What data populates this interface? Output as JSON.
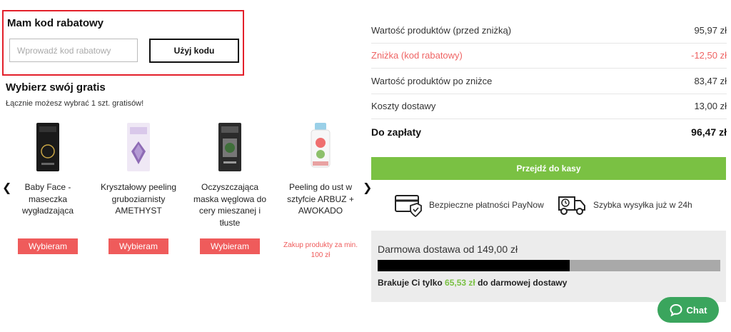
{
  "coupon": {
    "title": "Mam kod rabatowy",
    "placeholder": "Wprowadź kod rabatowy",
    "button": "Użyj kodu"
  },
  "gifts": {
    "title": "Wybierz swój gratis",
    "subtitle": "Łącznie możesz wybrać 1 szt. gratisów!",
    "items": [
      {
        "name": "Baby Face - maseczka wygładzająca",
        "button": "Wybieram"
      },
      {
        "name": "Kryształowy peeling gruboziarnisty AMETHYST",
        "button": "Wybieram"
      },
      {
        "name": "Oczyszczająca maska węglowa do cery mieszanej i tłuste",
        "button": "Wybieram"
      },
      {
        "name": "Peeling do ust w sztyfcie ARBUZ + AWOKADO",
        "note": "Zakup produkty za min. 100 zł"
      }
    ]
  },
  "summary": {
    "rows": [
      {
        "label": "Wartość produktów (przed zniżką)",
        "value": "95,97 zł"
      },
      {
        "label": "Zniżka (kod rabatowy)",
        "value": "-12,50 zł"
      },
      {
        "label": "Wartość produktów po zniżce",
        "value": "83,47 zł"
      },
      {
        "label": "Koszty dostawy",
        "value": "13,00 zł"
      },
      {
        "label": "Do zapłaty",
        "value": "96,47 zł"
      }
    ],
    "checkout": "Przejdź do kasy"
  },
  "features": {
    "payment": "Bezpieczne płatności PayNow",
    "shipping": "Szybka wysyłka już w 24h"
  },
  "free_shipping": {
    "title": "Darmowa dostawa od 149,00 zł",
    "progress": 0.56,
    "msg_before": "Brakuje Ci tylko ",
    "amount": "65,53 zł",
    "msg_after": " do darmowej dostawy"
  },
  "chat": {
    "label": "Chat"
  },
  "colors": {
    "accent_green": "#7ac143",
    "discount_red": "#ef6464",
    "coupon_border": "#e3202b",
    "gift_button": "#ef5b5b",
    "chat": "#3aa55d"
  }
}
